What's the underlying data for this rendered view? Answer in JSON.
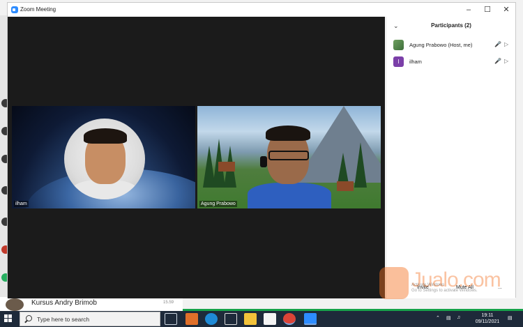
{
  "window": {
    "title": "Zoom Meeting",
    "minimize_icon": "minimize-icon",
    "maximize_icon": "maximize-icon",
    "close_icon": "close-icon"
  },
  "video_tiles": [
    {
      "name": "ilham"
    },
    {
      "name": "Agung Prabowo"
    }
  ],
  "participants_panel": {
    "title": "Participants (2)",
    "items": [
      {
        "name": "Agung Prabowo (Host, me)",
        "avatar": "photo"
      },
      {
        "name": "ilham",
        "avatar_letter": "I"
      }
    ],
    "footer": {
      "invite": "Invite",
      "mute_all": "Mute All",
      "more": "..."
    }
  },
  "background_app": {
    "chat_name": "Kursus Andry Brimob",
    "chat_time": "15.59"
  },
  "overlay": {
    "watermark": "Jualo.com",
    "activate_line1": "Activate Windows",
    "activate_line2": "Go to Settings to activate Windows."
  },
  "taskbar": {
    "search_placeholder": "Type here to search",
    "time": "19:11",
    "date": "09/11/2021"
  },
  "colors": {
    "zoom_blue": "#2d8cff",
    "taskbar": "#1e2a3a",
    "video_bg": "#1b1b1b",
    "avatar_letter_bg": "#7b3fa8",
    "watermark": "#f37021"
  }
}
